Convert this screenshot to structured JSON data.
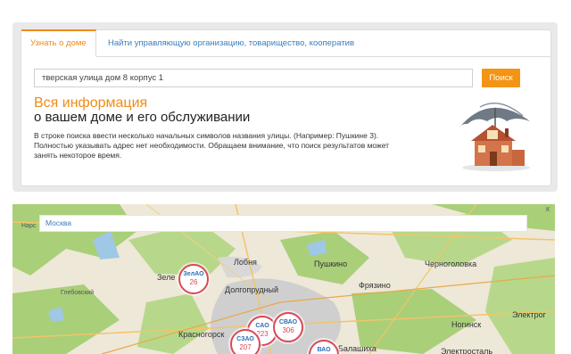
{
  "tabs": [
    {
      "label": "Узнать о доме"
    },
    {
      "label": "Найти управляющую организацию, товарищество, кооператив"
    }
  ],
  "search": {
    "value": "тверская улица дом 8 корпус 1",
    "button": "Поиск"
  },
  "info": {
    "heading1": "Вся информация",
    "heading2": "о вашем доме и его обслуживании",
    "description": "В строке поиска ввести несколько начальных символов названия улицы. (Например: Пушкине 3). Полностью указывать адрес нет необходимости. Обращаем внимание, что поиск результатов может занять некоторое время."
  },
  "map": {
    "search_text": "Москва",
    "labels": {
      "nara": "Нарс",
      "k": "К",
      "lobnya": "Лобня",
      "pushkino": "Пушкино",
      "chernogolovka": "Черноголовка",
      "zele": "Зеле",
      "dolgoprudny": "Долгопрудный",
      "fryazino": "Фрязино",
      "glebovsky": "Глебовский",
      "krasnogorsk": "Красногорск",
      "noginsk": "Ногинск",
      "elektrogorsk": "Электрог",
      "balashikha": "Балашиха",
      "elektrostal": "Электросталь"
    },
    "clusters": [
      {
        "name": "ЗелАО",
        "value": "26"
      },
      {
        "name": "САО",
        "value": "223"
      },
      {
        "name": "СВАО",
        "value": "306"
      },
      {
        "name": "СЗАО",
        "value": "207"
      },
      {
        "name": "ВАО",
        "value": ""
      }
    ],
    "colors": {
      "land": "#eee8d8",
      "forest": "#a9cf79",
      "water": "#9ec8e6",
      "city": "#cfcfcf",
      "cluster_border": "#d9495a"
    }
  }
}
